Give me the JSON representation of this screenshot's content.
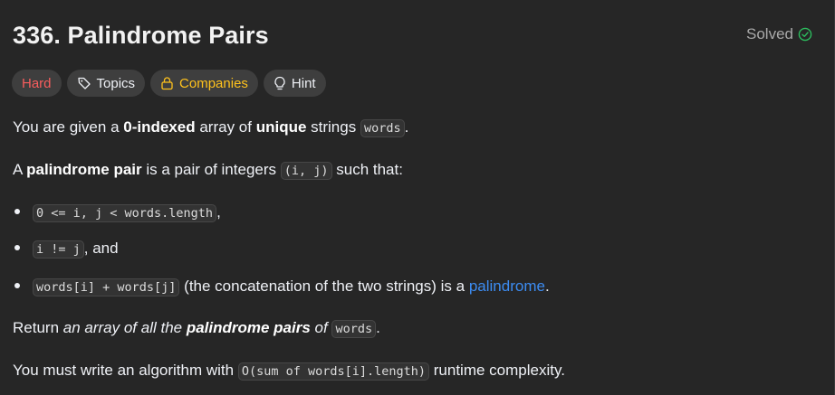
{
  "header": {
    "title": "336. Palindrome Pairs",
    "solved_label": "Solved",
    "solved_color": "#2cbb5d"
  },
  "chips": {
    "difficulty": "Hard",
    "topics": "Topics",
    "companies": "Companies",
    "hint": "Hint"
  },
  "colors": {
    "hard": "#f85d5d",
    "companies": "#ffc21c",
    "link": "#3c8cf2",
    "background": "#262626"
  },
  "description": {
    "p1": {
      "t1": "You are given a ",
      "b1": "0-indexed",
      "t2": " array of ",
      "b2": "unique",
      "t3": " strings ",
      "c1": "words",
      "t4": "."
    },
    "p2": {
      "t1": "A ",
      "b1": "palindrome pair",
      "t2": " is a pair of integers ",
      "c1": "(i, j)",
      "t3": " such that:"
    },
    "li1": {
      "c1": "0 <= i, j < words.length",
      "t1": ","
    },
    "li2": {
      "c1": "i != j",
      "t1": ", and"
    },
    "li3": {
      "c1": "words[i] + words[j]",
      "t1": " (the concatenation of the two strings) is a ",
      "link": "palindrome",
      "t2": "."
    },
    "p3": {
      "t1": "Return ",
      "i1": "an array of all the ",
      "bi1": "palindrome pairs",
      "i2": " of",
      "t2": " ",
      "c1": "words",
      "t3": "."
    },
    "p4": {
      "t1": "You must write an algorithm with ",
      "c1": "O(sum of words[i].length)",
      "t2": " runtime complexity."
    }
  }
}
